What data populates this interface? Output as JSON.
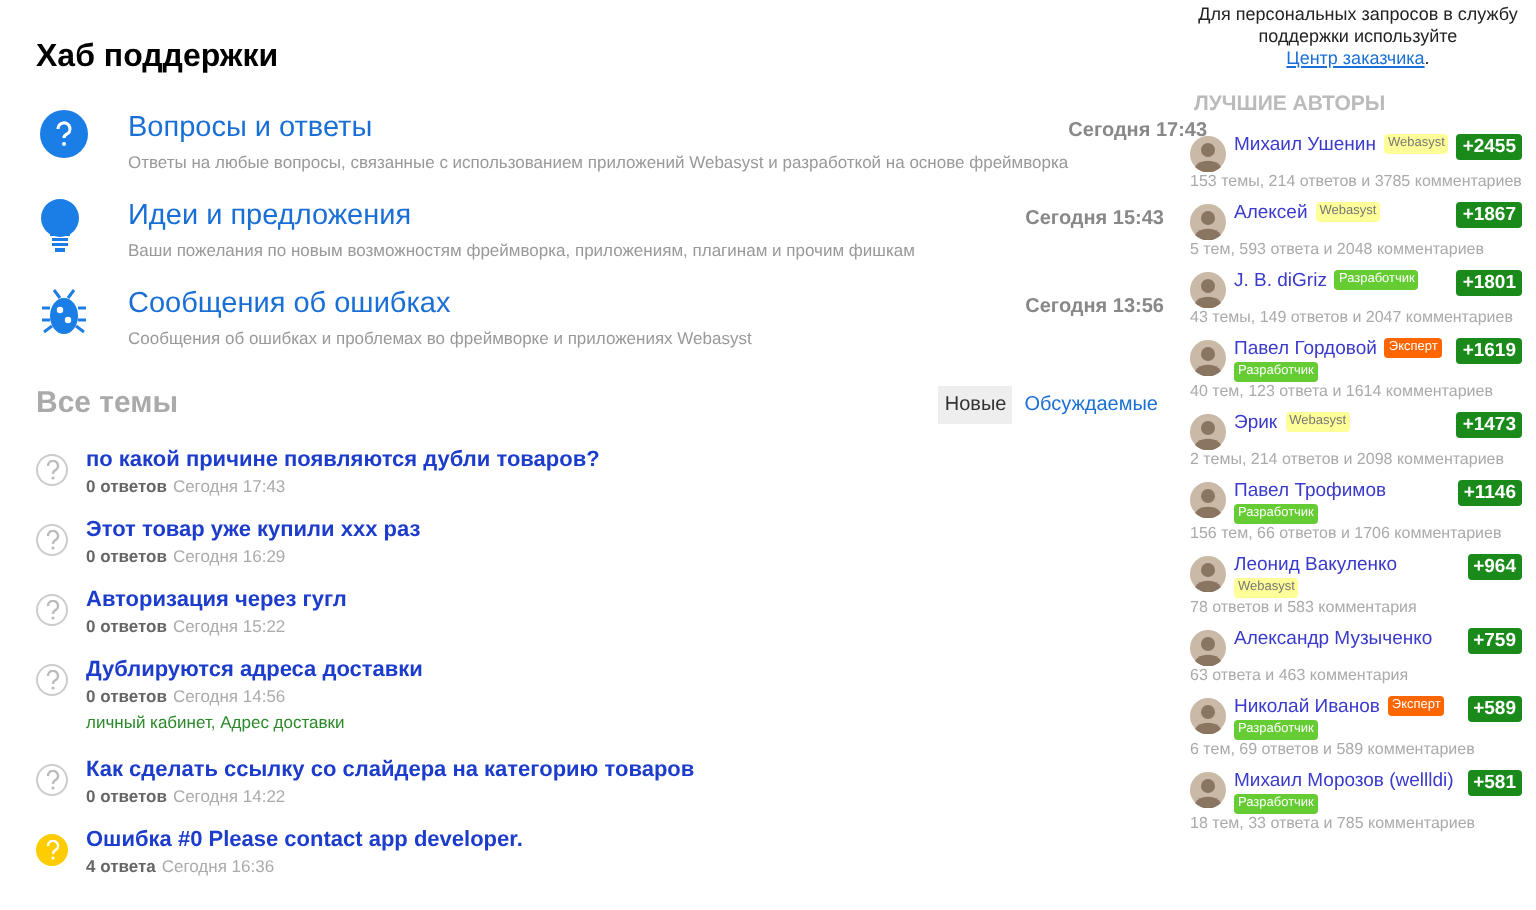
{
  "page_title": "Хаб поддержки",
  "hubs": [
    {
      "kind": "question",
      "title": "Вопросы и ответы",
      "description": "Ответы на любые вопросы, связанные с использованием приложений Webasyst и разработкой на основе фреймворка",
      "time": "Сегодня 17:43"
    },
    {
      "kind": "idea",
      "title": "Идеи и предложения",
      "description": "Ваши пожелания по новым возможностям фреймворка, приложениям, плагинам и прочим фишкам",
      "time": "Сегодня 15:43"
    },
    {
      "kind": "bug",
      "title": "Сообщения об ошибках",
      "description": "Сообщения об ошибках и проблемах во фреймворке и приложениях Webasyst",
      "time": "Сегодня 13:56"
    }
  ],
  "topics_heading": "Все темы",
  "sort_tabs": [
    {
      "label": "Новые",
      "selected": true
    },
    {
      "label": "Обсуждаемые",
      "selected": false
    }
  ],
  "topics": [
    {
      "title": "по какой причине появляются дубли товаров?",
      "answers": "0 ответов",
      "time": "Сегодня 17:43",
      "answered": false
    },
    {
      "title": "Этот товар уже купили ххх раз",
      "answers": "0 ответов",
      "time": "Сегодня 16:29",
      "answered": false
    },
    {
      "title": "Авторизация через гугл",
      "answers": "0 ответов",
      "time": "Сегодня 15:22",
      "answered": false
    },
    {
      "title": "Дублируются адреса доставки",
      "answers": "0 ответов",
      "time": "Сегодня 14:56",
      "answered": false,
      "tags": "личный кабинет, Адрес доставки"
    },
    {
      "title": "Как сделать ссылку со слайдера на категорию товаров",
      "answers": "0 ответов",
      "time": "Сегодня 14:22",
      "answered": false
    },
    {
      "title": "Ошибка #0 Please contact app developer.",
      "answers": "4 ответа",
      "time": "Сегодня 16:36",
      "answered": true
    }
  ],
  "sidebar": {
    "notice": "Для персональных запросов в службу поддержки используйте",
    "notice_link": "Центр заказчика",
    "notice_end": ".",
    "authors_heading": "ЛУЧШИЕ АВТОРЫ",
    "authors": [
      {
        "name": "Михаил Ушенин",
        "badges": [
          {
            "kind": "webasyst",
            "label": "Webasyst"
          }
        ],
        "stats": "153 темы, 214 ответов и 3785 комментариев",
        "score": "+2455"
      },
      {
        "name": "Алексей",
        "badges": [
          {
            "kind": "webasyst",
            "label": "Webasyst"
          }
        ],
        "stats": "5 тем, 593 ответа и 2048 комментариев",
        "score": "+1867"
      },
      {
        "name": "J. B. diGriz",
        "badges": [
          {
            "kind": "developer",
            "label": "Разработчик"
          }
        ],
        "stats": "43 темы, 149 ответов и 2047 комментариев",
        "score": "+1801"
      },
      {
        "name": "Павел Гордовой",
        "badges": [
          {
            "kind": "expert",
            "label": "Эксперт"
          },
          {
            "kind": "developer",
            "label": "Разработчик"
          }
        ],
        "stats": "40 тем, 123 ответа и 1614 комментариев",
        "score": "+1619"
      },
      {
        "name": "Эрик",
        "badges": [
          {
            "kind": "webasyst",
            "label": "Webasyst"
          }
        ],
        "stats": "2 темы, 214 ответов и 2098 комментариев",
        "score": "+1473"
      },
      {
        "name": "Павел Трофимов",
        "badges": [
          {
            "kind": "developer",
            "label": "Разработчик"
          }
        ],
        "stats": "156 тем, 66 ответов и 1706 комментариев",
        "score": "+1146"
      },
      {
        "name": "Леонид Вакуленко",
        "badges": [
          {
            "kind": "webasyst",
            "label": "Webasyst"
          }
        ],
        "stats": "78 ответов и 583 комментария",
        "score": "+964"
      },
      {
        "name": "Александр Музыченко",
        "stats": "63 ответа и 463 комментария",
        "score": "+759"
      },
      {
        "name": "Николай Иванов",
        "badges": [
          {
            "kind": "expert",
            "label": "Эксперт"
          },
          {
            "kind": "developer",
            "label": "Разработчик"
          }
        ],
        "stats": "6 тем, 69 ответов и 589 комментариев",
        "score": "+589"
      },
      {
        "name": "Михаил Морозов (wellldi)",
        "badges": [
          {
            "kind": "developer",
            "label": "Разработчик"
          }
        ],
        "stats": "18 тем, 33 ответа и 785 комментариев",
        "score": "+581"
      }
    ]
  }
}
